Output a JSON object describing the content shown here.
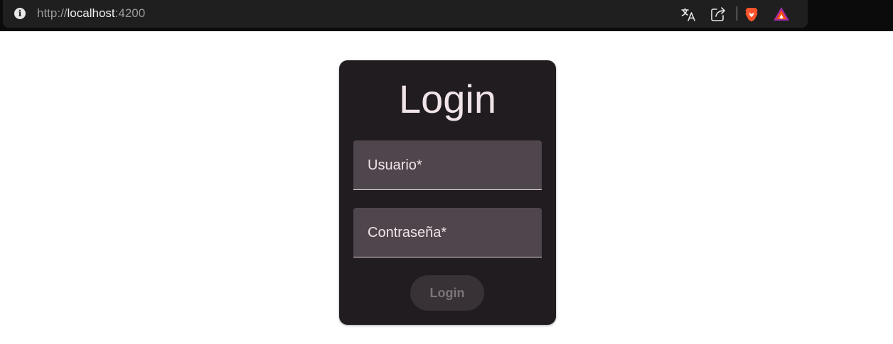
{
  "browser": {
    "url": {
      "scheme": "http://",
      "host": "localhost",
      "port": ":4200"
    },
    "icons": [
      "info-icon",
      "translate-icon",
      "share-icon",
      "brave-shield-icon",
      "brave-rewards-icon"
    ]
  },
  "login_card": {
    "title": "Login",
    "username_label": "Usuario*",
    "password_label": "Contraseña*",
    "submit_label": "Login"
  },
  "colors": {
    "card_background": "#201c20",
    "field_background": "#4f454c",
    "text": "#f1e4e8",
    "button_disabled": "#383236"
  }
}
